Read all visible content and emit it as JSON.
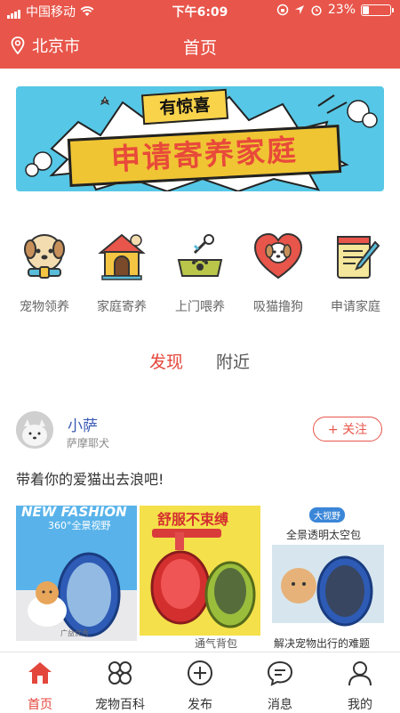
{
  "status_bar": {
    "carrier": "中国移动",
    "time": "下午6:09",
    "battery_text": "23%",
    "battery_level": 0.23
  },
  "header": {
    "location": "北京市",
    "title": "首页",
    "bg_color": "#e8554a"
  },
  "banner": {
    "subtitle": "有惊喜",
    "title": "申请寄养家庭"
  },
  "categories": [
    {
      "label": "宠物领养",
      "icon": "dog-face-icon"
    },
    {
      "label": "家庭寄养",
      "icon": "dog-house-icon"
    },
    {
      "label": "上门喂养",
      "icon": "food-bowl-icon"
    },
    {
      "label": "吸猫撸狗",
      "icon": "heart-pet-icon"
    },
    {
      "label": "申请家庭",
      "icon": "form-pencil-icon"
    }
  ],
  "feed_tabs": {
    "active": "发现",
    "other": "附近"
  },
  "post": {
    "username": "小萨",
    "breed": "萨摩耶犬",
    "follow_label": "+ 关注",
    "caption": "带着你的爱猫出去浪吧!",
    "photos": [
      {
        "title": "NEW FASHION",
        "subtitle": "360°全景视野",
        "footer": "广益优秀"
      },
      {
        "title": "舒服不束缚",
        "subtitle": "",
        "footer": "通气背包"
      },
      {
        "title": "全景透明太空包",
        "badge": "大视野",
        "footer": "解决宠物出行的难题"
      }
    ]
  },
  "tabbar": [
    {
      "label": "首页",
      "icon": "home-icon",
      "active": true
    },
    {
      "label": "宠物百科",
      "icon": "circles-grid-icon",
      "active": false
    },
    {
      "label": "发布",
      "icon": "plus-circle-icon",
      "active": false
    },
    {
      "label": "消息",
      "icon": "chat-bubble-icon",
      "active": false
    },
    {
      "label": "我的",
      "icon": "user-icon",
      "active": false
    }
  ],
  "colors": {
    "accent": "#e3463b",
    "banner_bg": "#56c7e6",
    "username": "#3b5bb5"
  }
}
